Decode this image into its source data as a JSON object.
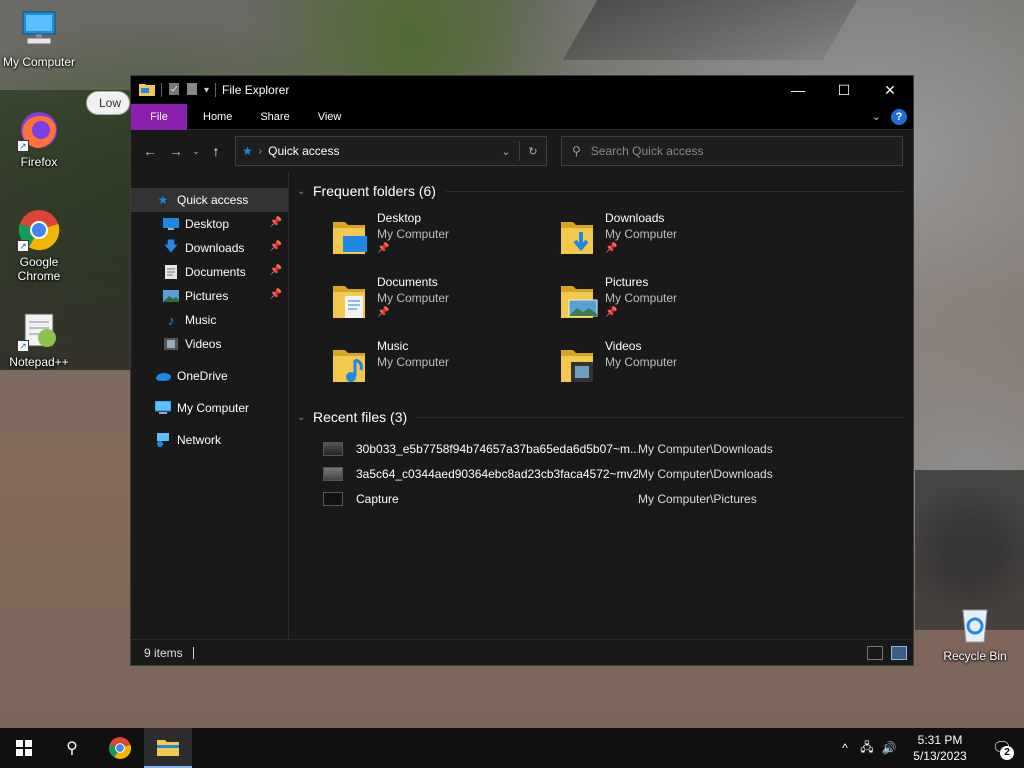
{
  "desktop": {
    "icons": [
      {
        "label": "My Computer",
        "icon": "computer-icon"
      },
      {
        "label": "Firefox",
        "icon": "firefox-icon"
      },
      {
        "label": "Google Chrome",
        "icon": "chrome-icon"
      },
      {
        "label": "Notepad++",
        "icon": "notepad-plus-plus-icon"
      },
      {
        "label": "Recycle Bin",
        "icon": "recycle-bin-icon"
      }
    ],
    "bubble_text": "Low"
  },
  "window": {
    "title": "File Explorer",
    "controls": {
      "minimize": "—",
      "maximize": "☐",
      "close": "✕"
    },
    "ribbon": {
      "tabs": [
        {
          "label": "File"
        },
        {
          "label": "Home"
        },
        {
          "label": "Share"
        },
        {
          "label": "View"
        }
      ],
      "help": "?"
    },
    "address": {
      "path": "Quick access",
      "search_placeholder": "Search Quick access"
    },
    "sidebar": {
      "quick_access": "Quick access",
      "pinned": [
        {
          "label": "Desktop",
          "pinned": true
        },
        {
          "label": "Downloads",
          "pinned": true
        },
        {
          "label": "Documents",
          "pinned": true
        },
        {
          "label": "Pictures",
          "pinned": true
        },
        {
          "label": "Music",
          "pinned": false
        },
        {
          "label": "Videos",
          "pinned": false
        }
      ],
      "onedrive": "OneDrive",
      "my_computer": "My Computer",
      "network": "Network"
    },
    "frequent": {
      "header": "Frequent folders (6)",
      "folders": [
        {
          "name": "Desktop",
          "location": "My Computer",
          "pinned": true
        },
        {
          "name": "Downloads",
          "location": "My Computer",
          "pinned": true
        },
        {
          "name": "Documents",
          "location": "My Computer",
          "pinned": true
        },
        {
          "name": "Pictures",
          "location": "My Computer",
          "pinned": true
        },
        {
          "name": "Music",
          "location": "My Computer",
          "pinned": false
        },
        {
          "name": "Videos",
          "location": "My Computer",
          "pinned": false
        }
      ]
    },
    "recent": {
      "header": "Recent files (3)",
      "files": [
        {
          "name": "30b033_e5b7758f94b74657a37ba65eda6d5b07~m...",
          "path": "My Computer\\Downloads"
        },
        {
          "name": "3a5c64_c0344aed90364ebc8ad23cb3faca4572~mv2",
          "path": "My Computer\\Downloads"
        },
        {
          "name": "Capture",
          "path": "My Computer\\Pictures"
        }
      ]
    },
    "status": {
      "items": "9 items"
    }
  },
  "taskbar": {
    "time": "5:31 PM",
    "date": "5/13/2023",
    "notifications": "2"
  },
  "colors": {
    "file_tab": "#8b1fae",
    "folder_yellow": "#f2c94c",
    "accent_blue": "#1e88e5"
  }
}
